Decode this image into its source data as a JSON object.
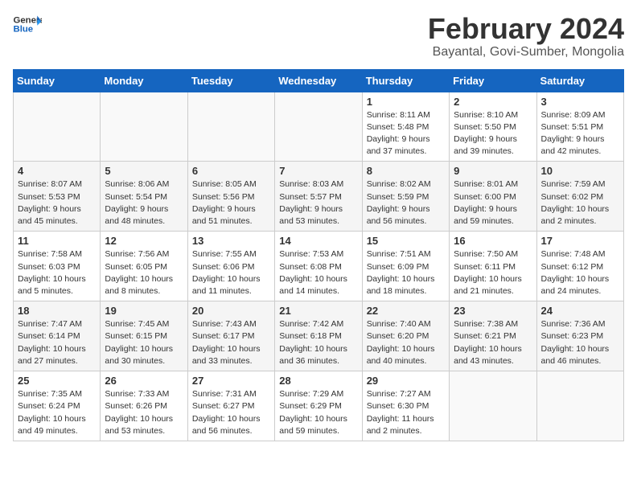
{
  "header": {
    "logo_line1": "General",
    "logo_line2": "Blue",
    "title": "February 2024",
    "subtitle": "Bayantal, Govi-Sumber, Mongolia"
  },
  "weekdays": [
    "Sunday",
    "Monday",
    "Tuesday",
    "Wednesday",
    "Thursday",
    "Friday",
    "Saturday"
  ],
  "weeks": [
    [
      {
        "day": "",
        "info": ""
      },
      {
        "day": "",
        "info": ""
      },
      {
        "day": "",
        "info": ""
      },
      {
        "day": "",
        "info": ""
      },
      {
        "day": "1",
        "info": "Sunrise: 8:11 AM\nSunset: 5:48 PM\nDaylight: 9 hours\nand 37 minutes."
      },
      {
        "day": "2",
        "info": "Sunrise: 8:10 AM\nSunset: 5:50 PM\nDaylight: 9 hours\nand 39 minutes."
      },
      {
        "day": "3",
        "info": "Sunrise: 8:09 AM\nSunset: 5:51 PM\nDaylight: 9 hours\nand 42 minutes."
      }
    ],
    [
      {
        "day": "4",
        "info": "Sunrise: 8:07 AM\nSunset: 5:53 PM\nDaylight: 9 hours\nand 45 minutes."
      },
      {
        "day": "5",
        "info": "Sunrise: 8:06 AM\nSunset: 5:54 PM\nDaylight: 9 hours\nand 48 minutes."
      },
      {
        "day": "6",
        "info": "Sunrise: 8:05 AM\nSunset: 5:56 PM\nDaylight: 9 hours\nand 51 minutes."
      },
      {
        "day": "7",
        "info": "Sunrise: 8:03 AM\nSunset: 5:57 PM\nDaylight: 9 hours\nand 53 minutes."
      },
      {
        "day": "8",
        "info": "Sunrise: 8:02 AM\nSunset: 5:59 PM\nDaylight: 9 hours\nand 56 minutes."
      },
      {
        "day": "9",
        "info": "Sunrise: 8:01 AM\nSunset: 6:00 PM\nDaylight: 9 hours\nand 59 minutes."
      },
      {
        "day": "10",
        "info": "Sunrise: 7:59 AM\nSunset: 6:02 PM\nDaylight: 10 hours\nand 2 minutes."
      }
    ],
    [
      {
        "day": "11",
        "info": "Sunrise: 7:58 AM\nSunset: 6:03 PM\nDaylight: 10 hours\nand 5 minutes."
      },
      {
        "day": "12",
        "info": "Sunrise: 7:56 AM\nSunset: 6:05 PM\nDaylight: 10 hours\nand 8 minutes."
      },
      {
        "day": "13",
        "info": "Sunrise: 7:55 AM\nSunset: 6:06 PM\nDaylight: 10 hours\nand 11 minutes."
      },
      {
        "day": "14",
        "info": "Sunrise: 7:53 AM\nSunset: 6:08 PM\nDaylight: 10 hours\nand 14 minutes."
      },
      {
        "day": "15",
        "info": "Sunrise: 7:51 AM\nSunset: 6:09 PM\nDaylight: 10 hours\nand 18 minutes."
      },
      {
        "day": "16",
        "info": "Sunrise: 7:50 AM\nSunset: 6:11 PM\nDaylight: 10 hours\nand 21 minutes."
      },
      {
        "day": "17",
        "info": "Sunrise: 7:48 AM\nSunset: 6:12 PM\nDaylight: 10 hours\nand 24 minutes."
      }
    ],
    [
      {
        "day": "18",
        "info": "Sunrise: 7:47 AM\nSunset: 6:14 PM\nDaylight: 10 hours\nand 27 minutes."
      },
      {
        "day": "19",
        "info": "Sunrise: 7:45 AM\nSunset: 6:15 PM\nDaylight: 10 hours\nand 30 minutes."
      },
      {
        "day": "20",
        "info": "Sunrise: 7:43 AM\nSunset: 6:17 PM\nDaylight: 10 hours\nand 33 minutes."
      },
      {
        "day": "21",
        "info": "Sunrise: 7:42 AM\nSunset: 6:18 PM\nDaylight: 10 hours\nand 36 minutes."
      },
      {
        "day": "22",
        "info": "Sunrise: 7:40 AM\nSunset: 6:20 PM\nDaylight: 10 hours\nand 40 minutes."
      },
      {
        "day": "23",
        "info": "Sunrise: 7:38 AM\nSunset: 6:21 PM\nDaylight: 10 hours\nand 43 minutes."
      },
      {
        "day": "24",
        "info": "Sunrise: 7:36 AM\nSunset: 6:23 PM\nDaylight: 10 hours\nand 46 minutes."
      }
    ],
    [
      {
        "day": "25",
        "info": "Sunrise: 7:35 AM\nSunset: 6:24 PM\nDaylight: 10 hours\nand 49 minutes."
      },
      {
        "day": "26",
        "info": "Sunrise: 7:33 AM\nSunset: 6:26 PM\nDaylight: 10 hours\nand 53 minutes."
      },
      {
        "day": "27",
        "info": "Sunrise: 7:31 AM\nSunset: 6:27 PM\nDaylight: 10 hours\nand 56 minutes."
      },
      {
        "day": "28",
        "info": "Sunrise: 7:29 AM\nSunset: 6:29 PM\nDaylight: 10 hours\nand 59 minutes."
      },
      {
        "day": "29",
        "info": "Sunrise: 7:27 AM\nSunset: 6:30 PM\nDaylight: 11 hours\nand 2 minutes."
      },
      {
        "day": "",
        "info": ""
      },
      {
        "day": "",
        "info": ""
      }
    ]
  ]
}
